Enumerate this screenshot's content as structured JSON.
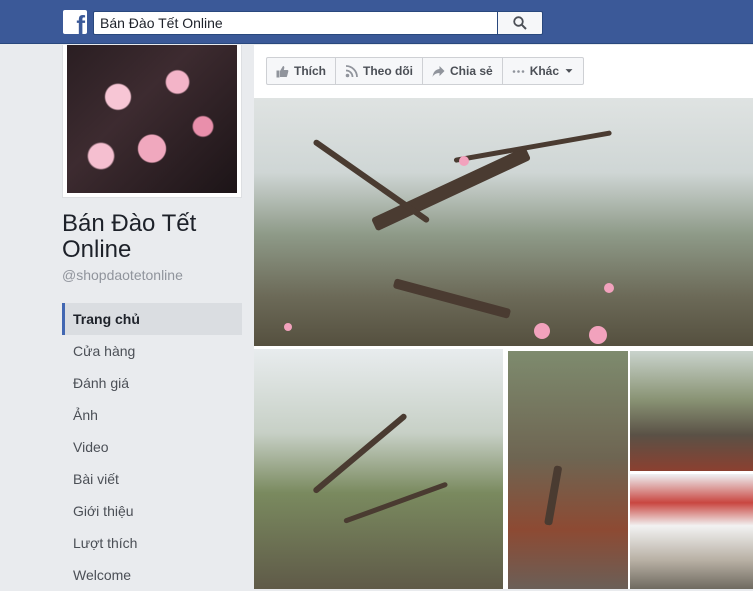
{
  "header": {
    "logo": "f",
    "search_value": "Bán Đào Tết Online",
    "icons": {
      "logo": "facebook-logo-icon",
      "search": "search-icon"
    },
    "colors": {
      "bar": "#3b5998"
    }
  },
  "sidebar": {
    "page_name": "Bán Đào Tết Online",
    "handle": "@shopdaotetonline",
    "items": [
      {
        "label": "Trang chủ",
        "active": true
      },
      {
        "label": "Cửa hàng"
      },
      {
        "label": "Đánh giá"
      },
      {
        "label": "Ảnh"
      },
      {
        "label": "Video"
      },
      {
        "label": "Bài viết"
      },
      {
        "label": "Giới thiệu"
      },
      {
        "label": "Lượt thích"
      },
      {
        "label": "Welcome"
      }
    ]
  },
  "actions": [
    {
      "label": "Thích",
      "icon": "thumbs-up-icon"
    },
    {
      "label": "Theo dõi",
      "icon": "rss-icon"
    },
    {
      "label": "Chia sẻ",
      "icon": "share-arrow-icon"
    },
    {
      "label": "Khác",
      "icon": "more-dots-icon"
    }
  ]
}
